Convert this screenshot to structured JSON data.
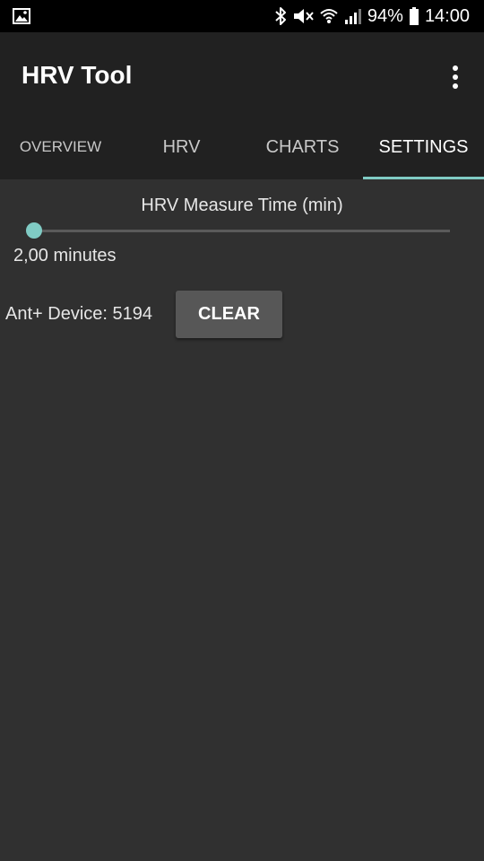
{
  "status_bar": {
    "left_icons": [
      "gallery-icon"
    ],
    "right_icons": [
      "bluetooth-icon",
      "vibrate-mute-icon",
      "wifi-icon",
      "signal-icon"
    ],
    "battery_percent": "94%",
    "time": "14:00"
  },
  "app_bar": {
    "title": "HRV Tool",
    "overflow_icon": "more-vert-icon"
  },
  "tabs": [
    {
      "label": "OVERVIEW",
      "active": false
    },
    {
      "label": "HRV",
      "active": false
    },
    {
      "label": "CHARTS",
      "active": false
    },
    {
      "label": "SETTINGS",
      "active": true
    }
  ],
  "settings": {
    "measure_time_label": "HRV Measure Time (min)",
    "measure_time_slider_fraction": 0.0,
    "measure_time_value": "2,00 minutes",
    "device_label": "Ant+ Device: 5194",
    "clear_button_label": "CLEAR"
  },
  "colors": {
    "accent": "#80cbc4",
    "app_bar": "#212121",
    "background": "#303030",
    "status_bar": "#000000",
    "button": "#575757"
  }
}
